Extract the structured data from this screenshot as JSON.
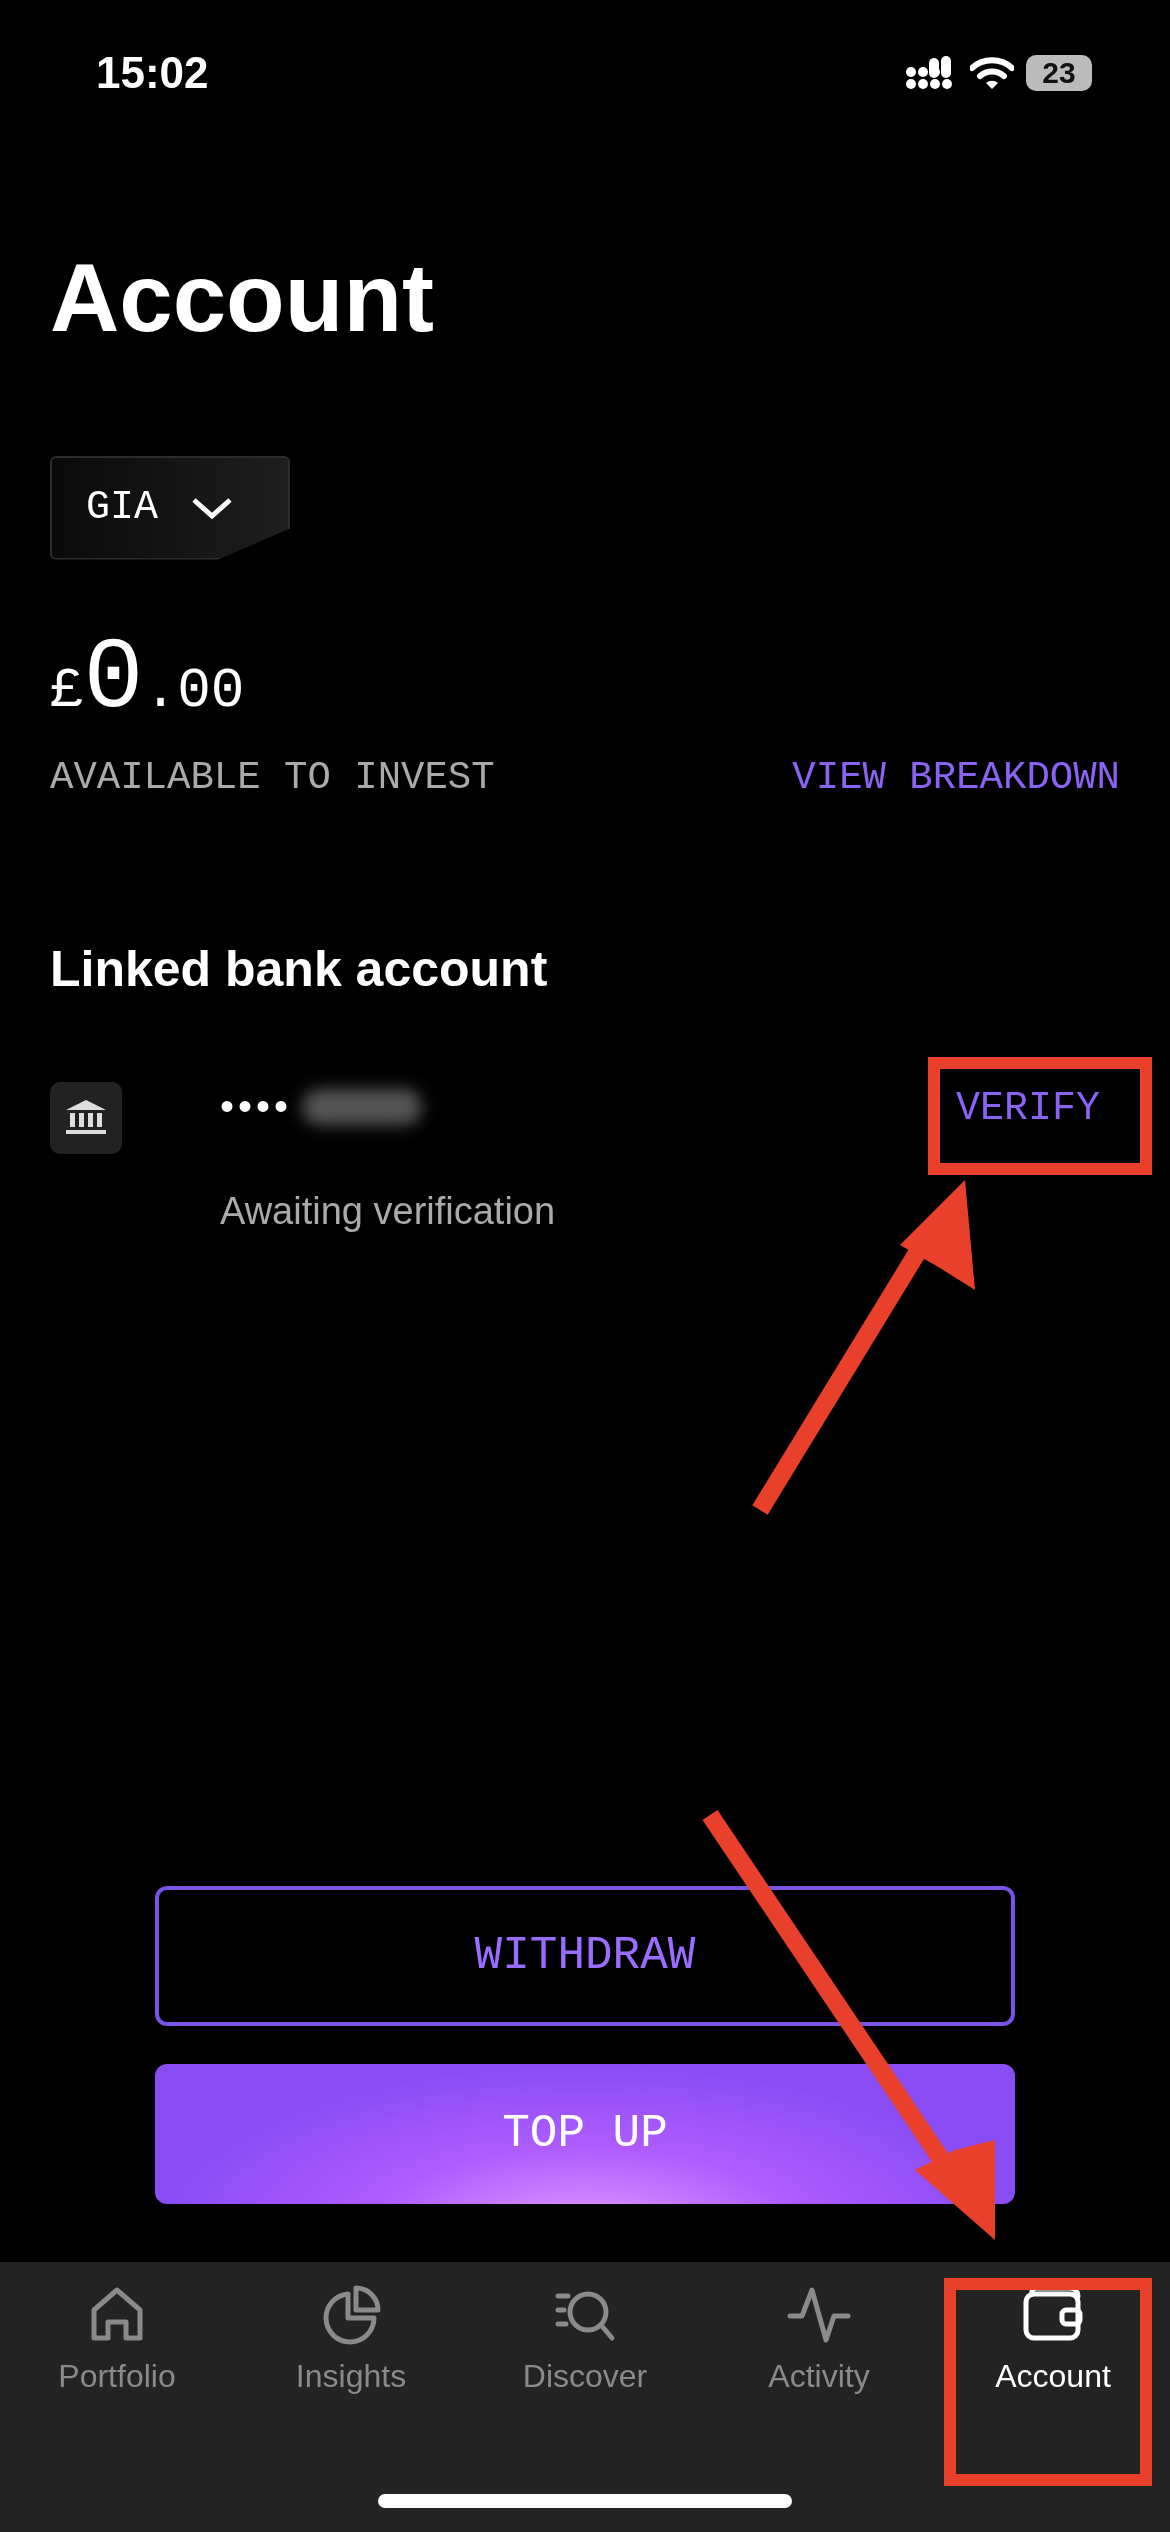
{
  "status_bar": {
    "time": "15:02",
    "battery": "23"
  },
  "title": "Account",
  "account_picker": {
    "value": "GIA"
  },
  "balance": {
    "currency": "£",
    "whole": "0",
    "fraction": ".00",
    "label": "AVAILABLE TO INVEST",
    "link": "VIEW BREAKDOWN"
  },
  "linked_bank": {
    "heading": "Linked bank account",
    "masked_number": "••••",
    "status": "Awaiting verification",
    "action": "VERIFY"
  },
  "buttons": [
    {
      "label": "WITHDRAW",
      "kind": "outline"
    },
    {
      "label": "TOP UP",
      "kind": "filled"
    }
  ],
  "tabs": [
    {
      "label": "Portfolio",
      "selected": false
    },
    {
      "label": "Insights",
      "selected": false
    },
    {
      "label": "Discover",
      "selected": false
    },
    {
      "label": "Activity",
      "selected": false
    },
    {
      "label": "Account",
      "selected": true
    }
  ]
}
